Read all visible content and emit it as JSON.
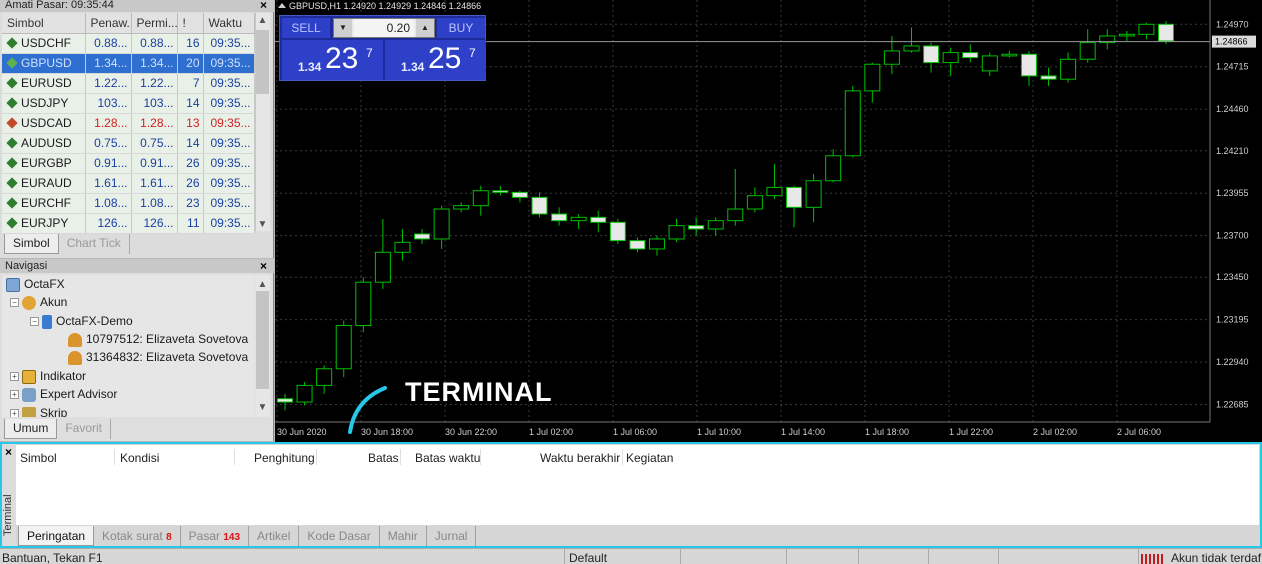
{
  "market_watch": {
    "title": "Amati Pasar: 09:35:44",
    "columns": [
      "Simbol",
      "Penaw...",
      "Permi...",
      "!",
      "Waktu"
    ],
    "rows": [
      {
        "symbol": "USDCHF",
        "bid": "0.88...",
        "ask": "0.88...",
        "spread": "16",
        "time": "09:35...",
        "dir": "up"
      },
      {
        "symbol": "GBPUSD",
        "bid": "1.34...",
        "ask": "1.34...",
        "spread": "20",
        "time": "09:35...",
        "dir": "up",
        "selected": true
      },
      {
        "symbol": "EURUSD",
        "bid": "1.22...",
        "ask": "1.22...",
        "spread": "7",
        "time": "09:35...",
        "dir": "up"
      },
      {
        "symbol": "USDJPY",
        "bid": "103...",
        "ask": "103...",
        "spread": "14",
        "time": "09:35...",
        "dir": "up"
      },
      {
        "symbol": "USDCAD",
        "bid": "1.28...",
        "ask": "1.28...",
        "spread": "13",
        "time": "09:35...",
        "dir": "down"
      },
      {
        "symbol": "AUDUSD",
        "bid": "0.75...",
        "ask": "0.75...",
        "spread": "14",
        "time": "09:35...",
        "dir": "up"
      },
      {
        "symbol": "EURGBP",
        "bid": "0.91...",
        "ask": "0.91...",
        "spread": "26",
        "time": "09:35...",
        "dir": "up"
      },
      {
        "symbol": "EURAUD",
        "bid": "1.61...",
        "ask": "1.61...",
        "spread": "26",
        "time": "09:35...",
        "dir": "up"
      },
      {
        "symbol": "EURCHF",
        "bid": "1.08...",
        "ask": "1.08...",
        "spread": "23",
        "time": "09:35...",
        "dir": "up"
      },
      {
        "symbol": "EURJPY",
        "bid": "126...",
        "ask": "126...",
        "spread": "11",
        "time": "09:35...",
        "dir": "up"
      }
    ],
    "tabs": [
      "Simbol",
      "Chart Tick"
    ],
    "close": "×"
  },
  "navigator": {
    "title": "Navigasi",
    "close": "×",
    "tree": [
      {
        "label": "OctaFX",
        "icon": "octafx-icon"
      },
      {
        "label": "Akun",
        "icon": "accounts-icon"
      },
      {
        "label": "OctaFX-Demo",
        "icon": "demo-server-icon"
      },
      {
        "label": "10797512: Elizaveta Sovetova",
        "icon": "user-icon"
      },
      {
        "label": "31364832: Elizaveta Sovetova",
        "icon": "user-icon"
      },
      {
        "label": "Indikator",
        "icon": "indicator-icon"
      },
      {
        "label": "Expert Advisor",
        "icon": "expert-advisor-icon"
      },
      {
        "label": "Skrip",
        "icon": "script-icon"
      }
    ],
    "tabs": [
      "Umum",
      "Favorit"
    ]
  },
  "chart": {
    "header": "GBPUSD,H1  1.24920 1.24929 1.24846 1.24866",
    "current_price_label": "1.24866",
    "colors": {
      "bull": "#00c000",
      "bear_fill": "#e8e8e8",
      "grid": "#3a3a3a",
      "axis_text": "#cfcfcf"
    },
    "one_click": {
      "sell_label": "SELL",
      "buy_label": "BUY",
      "volume": "0.20",
      "bid": {
        "prefix": "1.34",
        "big": "23",
        "sup": "7"
      },
      "ask": {
        "prefix": "1.34",
        "big": "25",
        "sup": "7"
      }
    },
    "annotation": "TERMINAL"
  },
  "chart_data": {
    "type": "candlestick",
    "y_ticks": [
      "1.24970",
      "1.24715",
      "1.24460",
      "1.24210",
      "1.23955",
      "1.23700",
      "1.23450",
      "1.23195",
      "1.22940",
      "1.22685"
    ],
    "x_ticks": [
      "30 Jun 2020",
      "30 Jun 18:00",
      "30 Jun 22:00",
      "1 Jul 02:00",
      "1 Jul 06:00",
      "1 Jul 10:00",
      "1 Jul 14:00",
      "1 Jul 18:00",
      "1 Jul 22:00",
      "2 Jul 02:00",
      "2 Jul 06:00"
    ],
    "ylim": [
      1.2258,
      1.2508
    ],
    "current_price": 1.24866,
    "candles": [
      [
        1.2272,
        1.2275,
        1.2265,
        1.227
      ],
      [
        1.227,
        1.2282,
        1.2268,
        1.228
      ],
      [
        1.228,
        1.2292,
        1.2275,
        1.229
      ],
      [
        1.229,
        1.2319,
        1.2285,
        1.2316
      ],
      [
        1.2316,
        1.2345,
        1.2312,
        1.2342
      ],
      [
        1.2342,
        1.238,
        1.2338,
        1.236
      ],
      [
        1.236,
        1.2374,
        1.2355,
        1.2366
      ],
      [
        1.2371,
        1.2374,
        1.2365,
        1.2368
      ],
      [
        1.2368,
        1.2388,
        1.2362,
        1.2386
      ],
      [
        1.2386,
        1.239,
        1.2384,
        1.2388
      ],
      [
        1.2388,
        1.24,
        1.2382,
        1.2397
      ],
      [
        1.2397,
        1.24,
        1.2394,
        1.2396
      ],
      [
        1.2396,
        1.2397,
        1.239,
        1.2393
      ],
      [
        1.2393,
        1.2396,
        1.2381,
        1.2383
      ],
      [
        1.2383,
        1.2387,
        1.2376,
        1.2379
      ],
      [
        1.2379,
        1.2383,
        1.2374,
        1.2381
      ],
      [
        1.2381,
        1.2385,
        1.2372,
        1.2378
      ],
      [
        1.2378,
        1.238,
        1.2365,
        1.2367
      ],
      [
        1.2367,
        1.2369,
        1.236,
        1.2362
      ],
      [
        1.2362,
        1.237,
        1.2358,
        1.2368
      ],
      [
        1.2368,
        1.238,
        1.2366,
        1.2376
      ],
      [
        1.2376,
        1.2381,
        1.237,
        1.2374
      ],
      [
        1.2374,
        1.2381,
        1.237,
        1.2379
      ],
      [
        1.2379,
        1.241,
        1.2376,
        1.2386
      ],
      [
        1.2386,
        1.2399,
        1.2384,
        1.2394
      ],
      [
        1.2394,
        1.2413,
        1.2392,
        1.2399
      ],
      [
        1.2399,
        1.24,
        1.2375,
        1.2387
      ],
      [
        1.2387,
        1.2407,
        1.2378,
        1.2403
      ],
      [
        1.2403,
        1.2422,
        1.2402,
        1.2418
      ],
      [
        1.2418,
        1.246,
        1.2417,
        1.2457
      ],
      [
        1.2457,
        1.2474,
        1.245,
        1.2473
      ],
      [
        1.2473,
        1.249,
        1.2467,
        1.2481
      ],
      [
        1.2481,
        1.2495,
        1.248,
        1.2484
      ],
      [
        1.2484,
        1.2486,
        1.2468,
        1.2474
      ],
      [
        1.2474,
        1.2483,
        1.2466,
        1.248
      ],
      [
        1.248,
        1.2485,
        1.2474,
        1.2477
      ],
      [
        1.2469,
        1.248,
        1.2466,
        1.2478
      ],
      [
        1.2478,
        1.2481,
        1.2477,
        1.2479
      ],
      [
        1.2479,
        1.2481,
        1.246,
        1.2466
      ],
      [
        1.2466,
        1.2471,
        1.246,
        1.2464
      ],
      [
        1.2464,
        1.248,
        1.2462,
        1.2476
      ],
      [
        1.2476,
        1.2494,
        1.2474,
        1.2486
      ],
      [
        1.2486,
        1.2494,
        1.2482,
        1.249
      ],
      [
        1.249,
        1.2493,
        1.2487,
        1.2491
      ],
      [
        1.2491,
        1.2498,
        1.2488,
        1.2497
      ],
      [
        1.2497,
        1.2499,
        1.2485,
        1.2487
      ]
    ]
  },
  "terminal": {
    "side_label": "Terminal",
    "close": "×",
    "columns": [
      "Simbol",
      "Kondisi",
      "Penghitung",
      "Batas",
      "Batas waktu",
      "Waktu berakhir",
      "Kegiatan"
    ],
    "tabs": [
      {
        "label": "Peringatan",
        "badge": "",
        "active": true
      },
      {
        "label": "Kotak surat",
        "badge": "8"
      },
      {
        "label": "Pasar",
        "badge": "143"
      },
      {
        "label": "Artikel",
        "badge": ""
      },
      {
        "label": "Kode Dasar",
        "badge": ""
      },
      {
        "label": "Mahir",
        "badge": ""
      },
      {
        "label": "Jurnal",
        "badge": ""
      }
    ]
  },
  "status_bar": {
    "help": "Bantuan, Tekan F1",
    "profile": "Default",
    "connection": "Akun tidak terdaf"
  }
}
